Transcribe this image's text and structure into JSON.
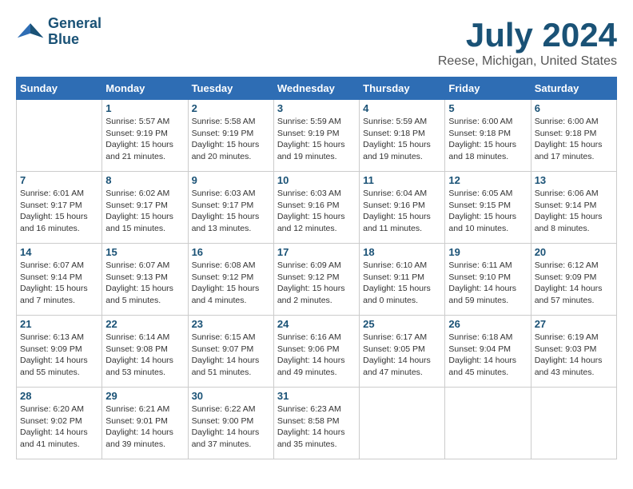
{
  "header": {
    "logo_line1": "General",
    "logo_line2": "Blue",
    "month_title": "July 2024",
    "location": "Reese, Michigan, United States"
  },
  "weekdays": [
    "Sunday",
    "Monday",
    "Tuesday",
    "Wednesday",
    "Thursday",
    "Friday",
    "Saturday"
  ],
  "weeks": [
    [
      {
        "day": "",
        "info": ""
      },
      {
        "day": "1",
        "info": "Sunrise: 5:57 AM\nSunset: 9:19 PM\nDaylight: 15 hours\nand 21 minutes."
      },
      {
        "day": "2",
        "info": "Sunrise: 5:58 AM\nSunset: 9:19 PM\nDaylight: 15 hours\nand 20 minutes."
      },
      {
        "day": "3",
        "info": "Sunrise: 5:59 AM\nSunset: 9:19 PM\nDaylight: 15 hours\nand 19 minutes."
      },
      {
        "day": "4",
        "info": "Sunrise: 5:59 AM\nSunset: 9:18 PM\nDaylight: 15 hours\nand 19 minutes."
      },
      {
        "day": "5",
        "info": "Sunrise: 6:00 AM\nSunset: 9:18 PM\nDaylight: 15 hours\nand 18 minutes."
      },
      {
        "day": "6",
        "info": "Sunrise: 6:00 AM\nSunset: 9:18 PM\nDaylight: 15 hours\nand 17 minutes."
      }
    ],
    [
      {
        "day": "7",
        "info": "Sunrise: 6:01 AM\nSunset: 9:17 PM\nDaylight: 15 hours\nand 16 minutes."
      },
      {
        "day": "8",
        "info": "Sunrise: 6:02 AM\nSunset: 9:17 PM\nDaylight: 15 hours\nand 15 minutes."
      },
      {
        "day": "9",
        "info": "Sunrise: 6:03 AM\nSunset: 9:17 PM\nDaylight: 15 hours\nand 13 minutes."
      },
      {
        "day": "10",
        "info": "Sunrise: 6:03 AM\nSunset: 9:16 PM\nDaylight: 15 hours\nand 12 minutes."
      },
      {
        "day": "11",
        "info": "Sunrise: 6:04 AM\nSunset: 9:16 PM\nDaylight: 15 hours\nand 11 minutes."
      },
      {
        "day": "12",
        "info": "Sunrise: 6:05 AM\nSunset: 9:15 PM\nDaylight: 15 hours\nand 10 minutes."
      },
      {
        "day": "13",
        "info": "Sunrise: 6:06 AM\nSunset: 9:14 PM\nDaylight: 15 hours\nand 8 minutes."
      }
    ],
    [
      {
        "day": "14",
        "info": "Sunrise: 6:07 AM\nSunset: 9:14 PM\nDaylight: 15 hours\nand 7 minutes."
      },
      {
        "day": "15",
        "info": "Sunrise: 6:07 AM\nSunset: 9:13 PM\nDaylight: 15 hours\nand 5 minutes."
      },
      {
        "day": "16",
        "info": "Sunrise: 6:08 AM\nSunset: 9:12 PM\nDaylight: 15 hours\nand 4 minutes."
      },
      {
        "day": "17",
        "info": "Sunrise: 6:09 AM\nSunset: 9:12 PM\nDaylight: 15 hours\nand 2 minutes."
      },
      {
        "day": "18",
        "info": "Sunrise: 6:10 AM\nSunset: 9:11 PM\nDaylight: 15 hours\nand 0 minutes."
      },
      {
        "day": "19",
        "info": "Sunrise: 6:11 AM\nSunset: 9:10 PM\nDaylight: 14 hours\nand 59 minutes."
      },
      {
        "day": "20",
        "info": "Sunrise: 6:12 AM\nSunset: 9:09 PM\nDaylight: 14 hours\nand 57 minutes."
      }
    ],
    [
      {
        "day": "21",
        "info": "Sunrise: 6:13 AM\nSunset: 9:09 PM\nDaylight: 14 hours\nand 55 minutes."
      },
      {
        "day": "22",
        "info": "Sunrise: 6:14 AM\nSunset: 9:08 PM\nDaylight: 14 hours\nand 53 minutes."
      },
      {
        "day": "23",
        "info": "Sunrise: 6:15 AM\nSunset: 9:07 PM\nDaylight: 14 hours\nand 51 minutes."
      },
      {
        "day": "24",
        "info": "Sunrise: 6:16 AM\nSunset: 9:06 PM\nDaylight: 14 hours\nand 49 minutes."
      },
      {
        "day": "25",
        "info": "Sunrise: 6:17 AM\nSunset: 9:05 PM\nDaylight: 14 hours\nand 47 minutes."
      },
      {
        "day": "26",
        "info": "Sunrise: 6:18 AM\nSunset: 9:04 PM\nDaylight: 14 hours\nand 45 minutes."
      },
      {
        "day": "27",
        "info": "Sunrise: 6:19 AM\nSunset: 9:03 PM\nDaylight: 14 hours\nand 43 minutes."
      }
    ],
    [
      {
        "day": "28",
        "info": "Sunrise: 6:20 AM\nSunset: 9:02 PM\nDaylight: 14 hours\nand 41 minutes."
      },
      {
        "day": "29",
        "info": "Sunrise: 6:21 AM\nSunset: 9:01 PM\nDaylight: 14 hours\nand 39 minutes."
      },
      {
        "day": "30",
        "info": "Sunrise: 6:22 AM\nSunset: 9:00 PM\nDaylight: 14 hours\nand 37 minutes."
      },
      {
        "day": "31",
        "info": "Sunrise: 6:23 AM\nSunset: 8:58 PM\nDaylight: 14 hours\nand 35 minutes."
      },
      {
        "day": "",
        "info": ""
      },
      {
        "day": "",
        "info": ""
      },
      {
        "day": "",
        "info": ""
      }
    ]
  ]
}
